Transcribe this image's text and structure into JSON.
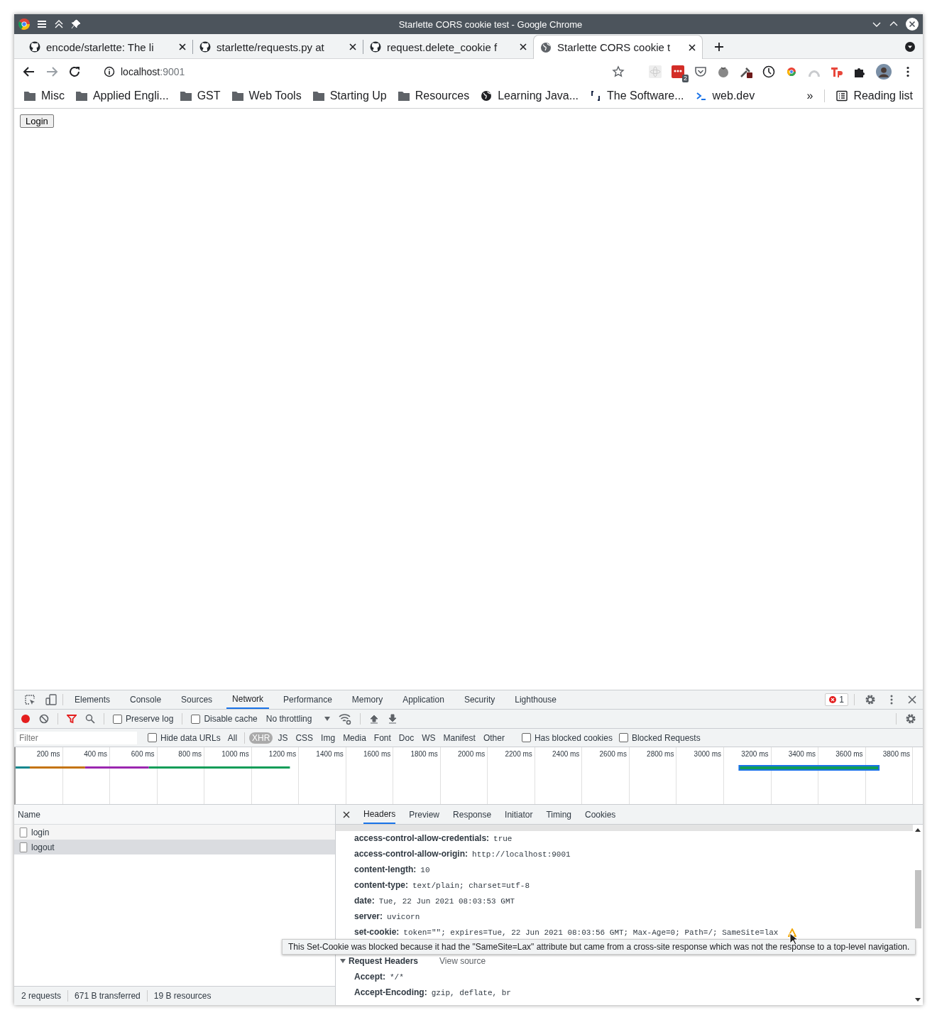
{
  "window": {
    "title": "Starlette CORS cookie test - Google Chrome"
  },
  "tabs": [
    {
      "label": "encode/starlette: The li",
      "selected": false
    },
    {
      "label": "starlette/requests.py at",
      "selected": false
    },
    {
      "label": "request.delete_cookie f",
      "selected": false
    },
    {
      "label": "Starlette CORS cookie t",
      "selected": true
    }
  ],
  "address": {
    "host": "localhost",
    "port": ":9001"
  },
  "extension_badge": "2",
  "bookmarks": [
    {
      "label": "Misc",
      "kind": "folder"
    },
    {
      "label": "Applied Engli...",
      "kind": "folder"
    },
    {
      "label": "GST",
      "kind": "folder"
    },
    {
      "label": "Web Tools",
      "kind": "folder"
    },
    {
      "label": "Starting Up",
      "kind": "folder"
    },
    {
      "label": "Resources",
      "kind": "folder"
    },
    {
      "label": "Learning Java...",
      "kind": "globe"
    },
    {
      "label": "The Software...",
      "kind": "bracket"
    },
    {
      "label": "web.dev",
      "kind": "prompt"
    }
  ],
  "bookmarks_more": "»",
  "reading_list": "Reading list",
  "page": {
    "button": "Login"
  },
  "devtools": {
    "tabs": [
      {
        "label": "Elements",
        "selected": false
      },
      {
        "label": "Console",
        "selected": false
      },
      {
        "label": "Sources",
        "selected": false
      },
      {
        "label": "Network",
        "selected": true
      },
      {
        "label": "Performance",
        "selected": false
      },
      {
        "label": "Memory",
        "selected": false
      },
      {
        "label": "Application",
        "selected": false
      },
      {
        "label": "Security",
        "selected": false
      },
      {
        "label": "Lighthouse",
        "selected": false
      }
    ],
    "error_count": "1",
    "toolbar": {
      "recording": true,
      "filter_active": true,
      "preserve_log": {
        "label": "Preserve log",
        "checked": false
      },
      "disable_cache": {
        "label": "Disable cache",
        "checked": false
      },
      "throttling": "No throttling"
    },
    "filter": {
      "placeholder": "Filter",
      "hide_data_urls": {
        "label": "Hide data URLs",
        "checked": false
      },
      "types": [
        {
          "label": "All",
          "selected": false
        },
        {
          "label": "XHR",
          "selected": true
        },
        {
          "label": "JS",
          "selected": false
        },
        {
          "label": "CSS",
          "selected": false
        },
        {
          "label": "Img",
          "selected": false
        },
        {
          "label": "Media",
          "selected": false
        },
        {
          "label": "Font",
          "selected": false
        },
        {
          "label": "Doc",
          "selected": false
        },
        {
          "label": "WS",
          "selected": false
        },
        {
          "label": "Manifest",
          "selected": false
        },
        {
          "label": "Other",
          "selected": false
        }
      ],
      "has_blocked_cookies": {
        "label": "Has blocked cookies",
        "checked": false
      },
      "blocked_requests": {
        "label": "Blocked Requests",
        "checked": false
      }
    },
    "timeline_ticks": [
      "200 ms",
      "400 ms",
      "600 ms",
      "800 ms",
      "1000 ms",
      "1200 ms",
      "1400 ms",
      "1600 ms",
      "1800 ms",
      "2000 ms",
      "2200 ms",
      "2400 ms",
      "2600 ms",
      "2800 ms",
      "3000 ms",
      "3200 ms",
      "3400 ms",
      "3600 ms",
      "3800 ms"
    ],
    "requests": {
      "column": "Name",
      "rows": [
        {
          "name": "login",
          "selected": false
        },
        {
          "name": "logout",
          "selected": true
        }
      ]
    },
    "detail_tabs": [
      {
        "label": "Headers",
        "selected": true
      },
      {
        "label": "Preview",
        "selected": false
      },
      {
        "label": "Response",
        "selected": false
      },
      {
        "label": "Initiator",
        "selected": false
      },
      {
        "label": "Timing",
        "selected": false
      },
      {
        "label": "Cookies",
        "selected": false
      }
    ],
    "response_headers": [
      {
        "name": "access-control-allow-credentials:",
        "value": "true",
        "warning": false
      },
      {
        "name": "access-control-allow-origin:",
        "value": "http://localhost:9001",
        "warning": false
      },
      {
        "name": "content-length:",
        "value": "10",
        "warning": false
      },
      {
        "name": "content-type:",
        "value": "text/plain; charset=utf-8",
        "warning": false
      },
      {
        "name": "date:",
        "value": "Tue, 22 Jun 2021 08:03:53 GMT",
        "warning": false
      },
      {
        "name": "server:",
        "value": "uvicorn",
        "warning": false
      },
      {
        "name": "set-cookie:",
        "value": "token=\"\"; expires=Tue, 22 Jun 2021 08:03:56 GMT; Max-Age=0; Path=/; SameSite=lax",
        "warning": true
      }
    ],
    "tooltip": "This Set-Cookie was blocked because it had the \"SameSite=Lax\" attribute but came from a cross-site response which was not the response to a top-level navigation.",
    "request_headers": {
      "title": "Request Headers",
      "view_source": "View source",
      "expanded": true,
      "rows": [
        {
          "name": "Accept:",
          "value": "*/*"
        },
        {
          "name": "Accept-Encoding:",
          "value": "gzip, deflate, br"
        }
      ]
    },
    "status": [
      "2 requests",
      "671 B transferred",
      "19 B resources"
    ]
  }
}
